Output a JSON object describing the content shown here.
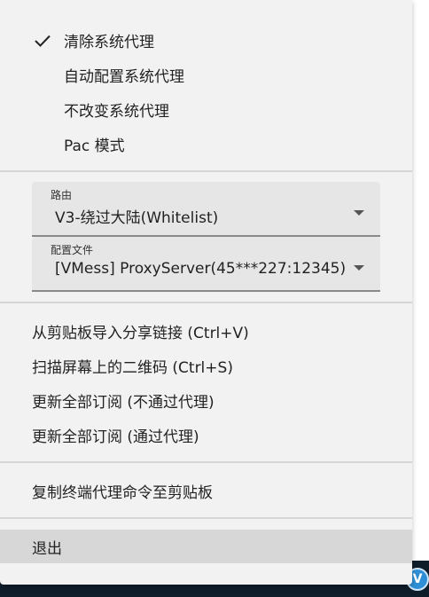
{
  "proxy_modes": [
    {
      "label": "清除系统代理",
      "checked": true
    },
    {
      "label": "自动配置系统代理",
      "checked": false
    },
    {
      "label": "不改变系统代理",
      "checked": false
    },
    {
      "label": "Pac 模式",
      "checked": false
    }
  ],
  "routing": {
    "label": "路由",
    "value": "V3-绕过大陆(Whitelist)"
  },
  "profile": {
    "label": "配置文件",
    "value": "[VMess] ProxyServer(45***227:12345)"
  },
  "actions": [
    {
      "label": "从剪贴板导入分享链接 (Ctrl+V)"
    },
    {
      "label": "扫描屏幕上的二维码 (Ctrl+S)"
    },
    {
      "label": "更新全部订阅 (不通过代理)"
    },
    {
      "label": "更新全部订阅 (通过代理)"
    }
  ],
  "copy_command": {
    "label": "复制终端代理命令至剪贴板"
  },
  "exit": {
    "label": "退出"
  },
  "colors": {
    "menu_bg": "#f2f2f2",
    "hover_bg": "#d7d7d7",
    "taskbar": "#0f1c2a",
    "tray_icon": "#2e8fd6"
  },
  "icons": {
    "check": "check-icon",
    "dropdown": "dropdown-arrow-icon",
    "tray": "v2rayn-tray-icon"
  }
}
